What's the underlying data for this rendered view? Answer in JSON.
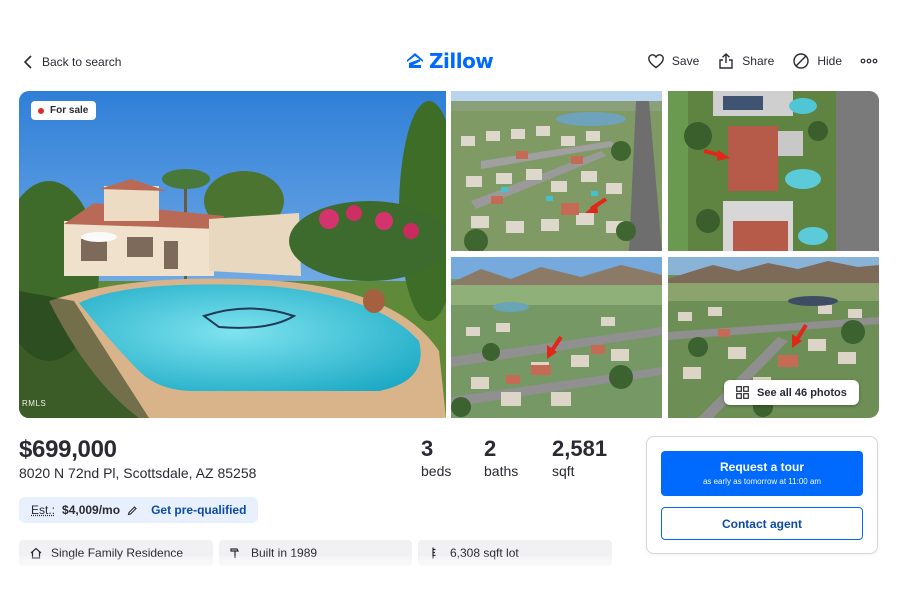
{
  "header": {
    "back_label": "Back to search",
    "logo_text": "Zillow",
    "actions": {
      "save": "Save",
      "share": "Share",
      "hide": "Hide"
    }
  },
  "gallery": {
    "status_badge": "For sale",
    "mls_mark": "RMLS",
    "see_all_label": "See all 46 photos"
  },
  "listing": {
    "price": "$699,000",
    "address": "8020 N 72nd Pl, Scottsdale, AZ 85258",
    "beds": {
      "value": "3",
      "label": "beds"
    },
    "baths": {
      "value": "2",
      "label": "baths"
    },
    "sqft": {
      "value": "2,581",
      "label": "sqft"
    }
  },
  "estimate": {
    "label": "Est.:",
    "amount": "$4,009/mo",
    "prequal_label": "Get pre-qualified"
  },
  "facts": [
    {
      "icon": "house-icon",
      "text": "Single Family Residence"
    },
    {
      "icon": "hammer-icon",
      "text": "Built in 1989"
    },
    {
      "icon": "ruler-icon",
      "text": "6,308 sqft lot"
    }
  ],
  "contact": {
    "tour_label": "Request a tour",
    "tour_sub": "as early as tomorrow at 11:00 am",
    "agent_label": "Contact agent"
  },
  "colors": {
    "brand": "#006aff",
    "text": "#2a2a33",
    "badge_dot": "#d93025",
    "estimate_bg": "#e8f0fe"
  }
}
